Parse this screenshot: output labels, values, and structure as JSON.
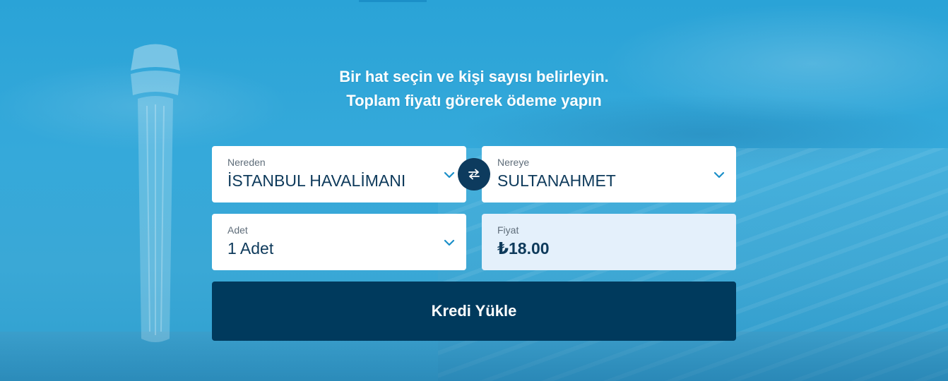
{
  "hero": {
    "heading_line1": "Bir hat seçin ve kişi sayısı belirleyin.",
    "heading_line2": "Toplam fiyatı görerek ödeme yapın"
  },
  "form": {
    "from": {
      "label": "Nereden",
      "value": "İSTANBUL HAVALİMANI",
      "icon": "chevron-down-icon"
    },
    "swap": {
      "icon": "swap-arrows-icon"
    },
    "to": {
      "label": "Nereye",
      "value": "SULTANAHMET",
      "icon": "chevron-down-icon"
    },
    "quantity": {
      "label": "Adet",
      "value": "1 Adet",
      "icon": "chevron-down-icon"
    },
    "price": {
      "label": "Fiyat",
      "value": "₺18.00"
    },
    "submit_label": "Kredi Yükle"
  },
  "colors": {
    "background": "#2aa3d7",
    "primary_dark": "#003a5d",
    "text_dark": "#0e3a5b",
    "accent": "#1b8fc8",
    "price_field_bg": "#e4f0fb",
    "white": "#ffffff"
  }
}
